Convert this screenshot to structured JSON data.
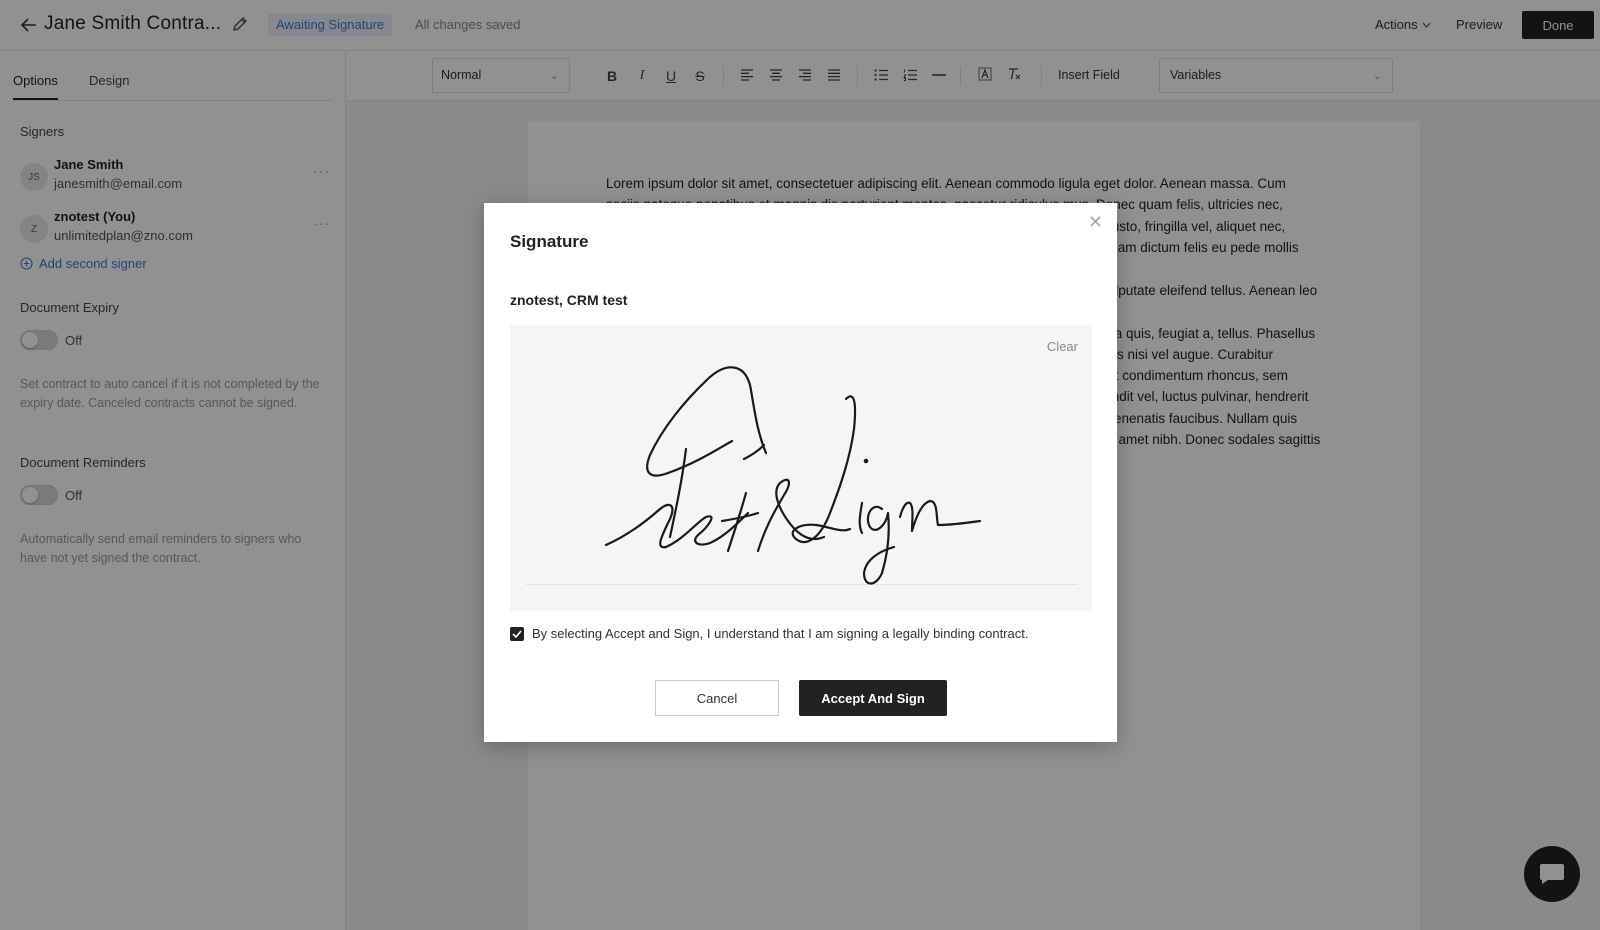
{
  "header": {
    "title": "Jane Smith Contra...",
    "status": "Awaiting Signature",
    "save_status": "All changes saved",
    "actions_label": "Actions",
    "preview_label": "Preview",
    "done_label": "Done"
  },
  "sidebar": {
    "tabs": [
      {
        "label": "Options",
        "active": true
      },
      {
        "label": "Design",
        "active": false
      }
    ],
    "signers_label": "Signers",
    "signers": [
      {
        "initials": "JS",
        "name": "Jane Smith",
        "email": "janesmith@email.com"
      },
      {
        "initials": "Z",
        "name": "znotest (You)",
        "email": "unlimitedplan@zno.com"
      }
    ],
    "add_signer_label": "Add second signer",
    "expiry": {
      "label": "Document Expiry",
      "toggle_label": "Off",
      "help": "Set contract to auto cancel if it is not completed by the expiry date. Canceled contracts cannot be signed."
    },
    "reminders": {
      "label": "Document Reminders",
      "toggle_label": "Off",
      "help": "Automatically send email reminders to signers who have not yet signed the contract."
    }
  },
  "toolbar": {
    "format_value": "Normal",
    "bold": "B",
    "italic": "I",
    "underline": "U",
    "strike": "S",
    "insert_field_label": "Insert Field",
    "variables_value": "Variables"
  },
  "document": {
    "lines": [
      "Lorem ipsum dolor sit amet, consectetuer adipiscing elit. Aenean commodo ligula eget dolor. Aenean massa. Cum",
      "sociis natoque penatibus et magnis dis parturient montes, nascetur ridiculus mus. Donec quam felis, ultricies nec,",
      "pellentesque eu, pretium quis, sem. Nulla consequat massa quis enim. Donec pede justo, fringilla vel, aliquet nec,",
      "vulputate eget, arcu. In enim justo, rhoncus ut, imperdiet a, venenatis vitae, justo. Nullam dictum felis eu pede mollis",
      "",
      "pretium. Integer tincidunt. Cras dapibus. Vivamus elementum semper nisi. Aenean vulputate eleifend tellus. Aenean leo ligula,",
      "porttitor eu, consequat vitae, eleifend ac, enim. Aliquam lorem ante, dapibus in, viverra quis, feugiat a, tellus. Phasellus",
      "viverra nulla ut metus varius laoreet. Quisque rutrum. Aenean imperdiet. Etiam ultricies nisi vel augue. Curabitur",
      "ullamcorper ultricies nisi. Nam eget dui. Etiam rhoncus. Maecenas tempus, tellus eget condimentum rhoncus, sem",
      "quam semper libero, sit amet adipiscing sem neque sed ipsum. Nam quam nunc, blandit vel, luctus pulvinar, hendrerit",
      "id, lorem. Maecenas nec odio et ante tincidunt tempus. Donec vitae sapien ut libero venenatis faucibus. Nullam quis",
      "ante. Etiam sit amet orci eget eros faucibus tincidunt. Duis leo. Sed fringilla mauris sit amet nibh. Donec sodales sagittis"
    ]
  },
  "modal": {
    "title": "Signature",
    "signer_line": "znotest, CRM test",
    "clear_label": "Clear",
    "consent_text": "By selecting Accept and Sign, I understand that I am signing a legally binding contract.",
    "consent_checked": true,
    "cancel_label": "Cancel",
    "accept_label": "Accept And Sign"
  },
  "icons": {
    "back": "arrow-left-icon",
    "edit": "pencil-icon",
    "close": "close-icon",
    "chat": "chat-bubble-icon",
    "add": "plus-circle-icon"
  },
  "colors": {
    "accent": "#3b7bc9",
    "primary": "#222222"
  }
}
